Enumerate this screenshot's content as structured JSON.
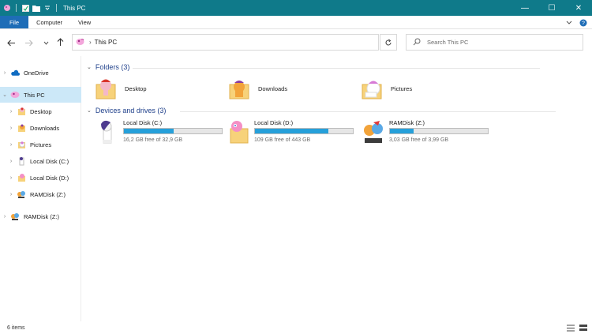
{
  "window": {
    "title": "This PC",
    "minimize_glyph": "—",
    "maximize_glyph": "☐",
    "close_glyph": "✕"
  },
  "ribbon": {
    "tabs": [
      "File",
      "Computer",
      "View"
    ],
    "help_glyph": "?",
    "expand_glyph": "⌄"
  },
  "navigation": {
    "back_glyph": "←",
    "forward_glyph": "→",
    "recent_glyph": "⌄",
    "up_glyph": "↑",
    "address_path": "This PC",
    "address_arrow": "›",
    "refresh_glyph": "↻",
    "search_placeholder": "Search This PC"
  },
  "sidebar": {
    "items": [
      {
        "label": "OneDrive",
        "icon": "onedrive-icon",
        "chevron": "›"
      },
      {
        "label": "This PC",
        "icon": "this-pc-icon",
        "chevron": "⌄",
        "selected": true
      },
      {
        "label": "Desktop",
        "icon": "desktop-folder-icon",
        "chevron": "›"
      },
      {
        "label": "Downloads",
        "icon": "downloads-folder-icon",
        "chevron": "›"
      },
      {
        "label": "Pictures",
        "icon": "pictures-folder-icon",
        "chevron": "›"
      },
      {
        "label": "Local Disk (C:)",
        "icon": "drive-c-icon",
        "chevron": "›"
      },
      {
        "label": "Local Disk (D:)",
        "icon": "drive-d-icon",
        "chevron": "›"
      },
      {
        "label": "RAMDisk (Z:)",
        "icon": "drive-z-icon",
        "chevron": "›"
      },
      {
        "label": "RAMDisk (Z:)",
        "icon": "ramdisk-network-icon",
        "chevron": "›"
      }
    ]
  },
  "content": {
    "folders_header": "Folders (3)",
    "folders": [
      {
        "label": "Desktop",
        "icon": "desktop-folder-icon"
      },
      {
        "label": "Downloads",
        "icon": "downloads-folder-icon"
      },
      {
        "label": "Pictures",
        "icon": "pictures-folder-icon"
      }
    ],
    "devices_header": "Devices and drives (3)",
    "drives": [
      {
        "label": "Local Disk (C:)",
        "free_text": "16,2 GB free of 32,9 GB",
        "used_fraction": 0.51,
        "icon": "drive-c-icon"
      },
      {
        "label": "Local Disk (D:)",
        "free_text": "109 GB free of 443 GB",
        "used_fraction": 0.75,
        "icon": "drive-d-icon"
      },
      {
        "label": "RAMDisk (Z:)",
        "free_text": "3,03 GB free of 3,99 GB",
        "used_fraction": 0.24,
        "icon": "drive-z-icon"
      }
    ],
    "group_chevron": "⌄"
  },
  "status": {
    "items_count": "6 items"
  },
  "colors": {
    "titlebar": "#0f7a8a",
    "file_tab": "#1e6db7",
    "selection": "#cce8f8",
    "drive_bar": "#26a0da",
    "group_header": "#1e3f8a"
  }
}
